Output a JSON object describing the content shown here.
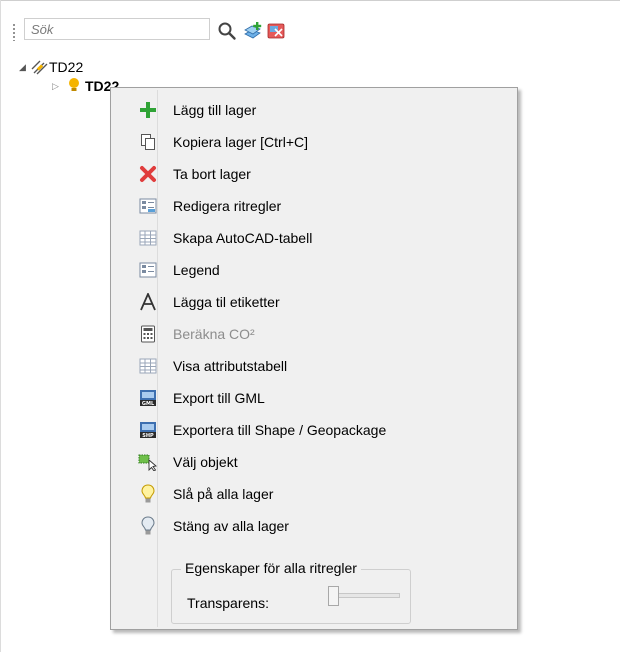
{
  "toolbar": {
    "search_placeholder": "Sök",
    "icons": [
      "search-icon",
      "add-layer-icon",
      "remove-map-icon"
    ]
  },
  "tree": {
    "root_label": "TD22",
    "child_label": "TD22"
  },
  "context_menu": {
    "items": [
      {
        "label": "Lägg till lager",
        "icon": "plus-icon",
        "enabled": true
      },
      {
        "label": "Kopiera lager [Ctrl+C]",
        "icon": "copy-icon",
        "enabled": true
      },
      {
        "label": "Ta bort lager",
        "icon": "delete-icon",
        "enabled": true
      },
      {
        "label": "Redigera ritregler",
        "icon": "style-rules-icon",
        "enabled": true
      },
      {
        "label": "Skapa AutoCAD-tabell",
        "icon": "table-icon",
        "enabled": true
      },
      {
        "label": "Legend",
        "icon": "legend-icon",
        "enabled": true
      },
      {
        "label": "Lägga til etiketter",
        "icon": "label-icon",
        "enabled": true
      },
      {
        "label": "Beräkna CO²",
        "icon": "calculator-icon",
        "enabled": false
      },
      {
        "label": "Visa attributstabell",
        "icon": "attribute-table-icon",
        "enabled": true
      },
      {
        "label": "Export till GML",
        "icon": "gml-export-icon",
        "enabled": true
      },
      {
        "label": "Exportera till Shape / Geopackage",
        "icon": "shp-export-icon",
        "enabled": true
      },
      {
        "label": "Välj objekt",
        "icon": "select-objects-icon",
        "enabled": true
      },
      {
        "label": "Slå på alla lager",
        "icon": "bulb-on-icon",
        "enabled": true
      },
      {
        "label": "Stäng av alla lager",
        "icon": "bulb-off-icon",
        "enabled": true
      }
    ],
    "group": {
      "title": "Egenskaper för alla ritregler",
      "transparency_label": "Transparens:",
      "transparency_value": 0
    }
  },
  "colors": {
    "menu_bg": "#f0f0f0",
    "accent_green": "#2fa336",
    "delete_red": "#e03c3c",
    "bulb_yellow": "#f5b400"
  }
}
